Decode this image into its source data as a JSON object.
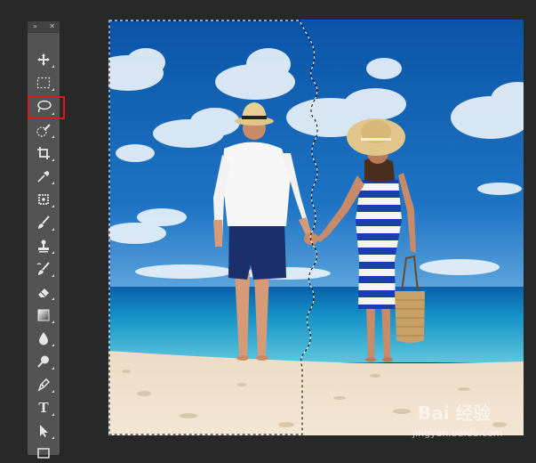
{
  "toolbar": {
    "collapse_glyph": "»",
    "close_glyph": "✕",
    "tools": [
      {
        "name": "move-tool",
        "icon": "move-icon"
      },
      {
        "name": "rectangular-marquee-tool",
        "icon": "marquee-icon"
      },
      {
        "name": "lasso-tool",
        "icon": "lasso-icon",
        "selected": true
      },
      {
        "name": "quick-selection-tool",
        "icon": "quick-selection-icon"
      },
      {
        "name": "crop-tool",
        "icon": "crop-icon"
      },
      {
        "name": "eyedropper-tool",
        "icon": "eyedropper-icon"
      },
      {
        "name": "spot-healing-tool",
        "icon": "healing-icon"
      },
      {
        "name": "brush-tool",
        "icon": "brush-icon"
      },
      {
        "name": "clone-stamp-tool",
        "icon": "stamp-icon"
      },
      {
        "name": "history-brush-tool",
        "icon": "history-brush-icon"
      },
      {
        "name": "eraser-tool",
        "icon": "eraser-icon"
      },
      {
        "name": "gradient-tool",
        "icon": "gradient-icon"
      },
      {
        "name": "blur-tool",
        "icon": "drop-icon"
      },
      {
        "name": "dodge-tool",
        "icon": "dodge-icon"
      },
      {
        "name": "pen-tool",
        "icon": "pen-icon"
      },
      {
        "name": "type-tool",
        "icon": "type-icon",
        "label": "T"
      },
      {
        "name": "path-selection-tool",
        "icon": "arrow-icon"
      },
      {
        "name": "rectangle-tool",
        "icon": "rectangle-icon"
      }
    ]
  },
  "highlight_color": "#e0161d",
  "watermark": {
    "brand": "Bai 经验",
    "url": "jingyan.baidu.com"
  }
}
